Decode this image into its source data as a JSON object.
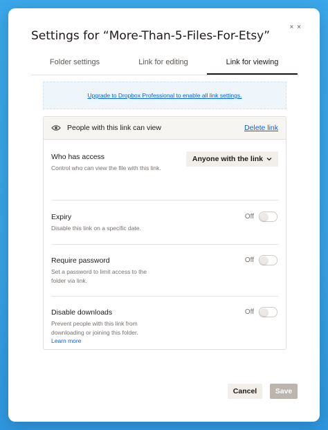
{
  "dialog": {
    "title": "Settings for “More-Than-5-Files-For-Etsy”",
    "close_glyph": "× ×"
  },
  "tabs": [
    {
      "label": "Folder settings",
      "active": false
    },
    {
      "label": "Link for editing",
      "active": false
    },
    {
      "label": "Link for viewing",
      "active": true
    }
  ],
  "banner": {
    "text": "Upgrade to Dropbox Professional to enable all link settings."
  },
  "panel": {
    "header_label": "People with this link can view",
    "delete_label": "Delete link",
    "who_has_access": {
      "title": "Who has access",
      "description": "Control who can view the file with this link.",
      "selected": "Anyone with the link"
    },
    "expiry": {
      "title": "Expiry",
      "description": "Disable this link on a specific date.",
      "state": "Off"
    },
    "require_password": {
      "title": "Require password",
      "description": "Set a password to limit access to the folder via link.",
      "state": "Off"
    },
    "disable_downloads": {
      "title": "Disable downloads",
      "description": "Prevent people with this link from downloading or joining this folder.",
      "learn_more": "Learn more",
      "state": "Off"
    }
  },
  "footer": {
    "cancel_label": "Cancel",
    "save_label": "Save"
  },
  "colors": {
    "accent": "#0061fe",
    "background": "#3aa7ea"
  }
}
